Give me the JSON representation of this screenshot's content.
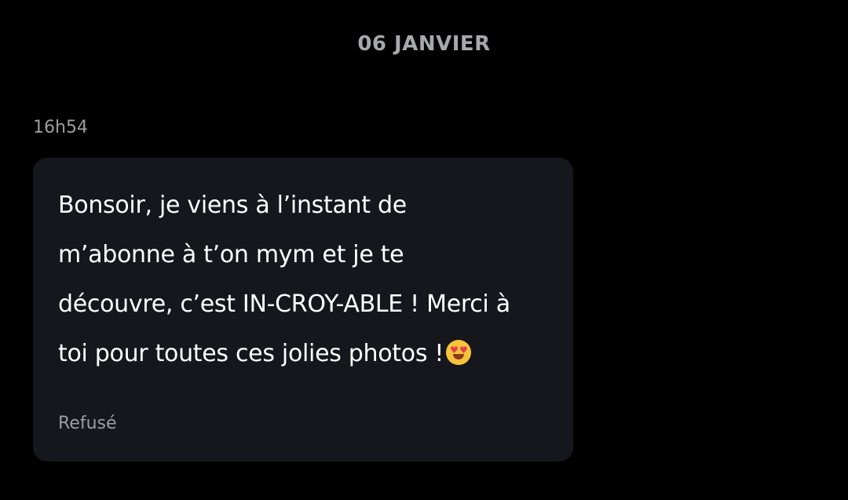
{
  "conversation": {
    "date_separator": "06 JANVIER",
    "messages": [
      {
        "time": "16h54",
        "lines": [
          "Bonsoir, je viens à l’instant de",
          "m’abonne à t’on mym et je te",
          "découvre, c’est IN-CROY-ABLE ! Merci à",
          "toi pour toutes ces jolies photos !"
        ],
        "emoji": "smiling-face-with-heart-eyes-icon",
        "status": "Refusé"
      }
    ]
  },
  "colors": {
    "background": "#000000",
    "bubble": "#15171c",
    "text": "#ffffff",
    "muted": "#9c9ea1"
  }
}
